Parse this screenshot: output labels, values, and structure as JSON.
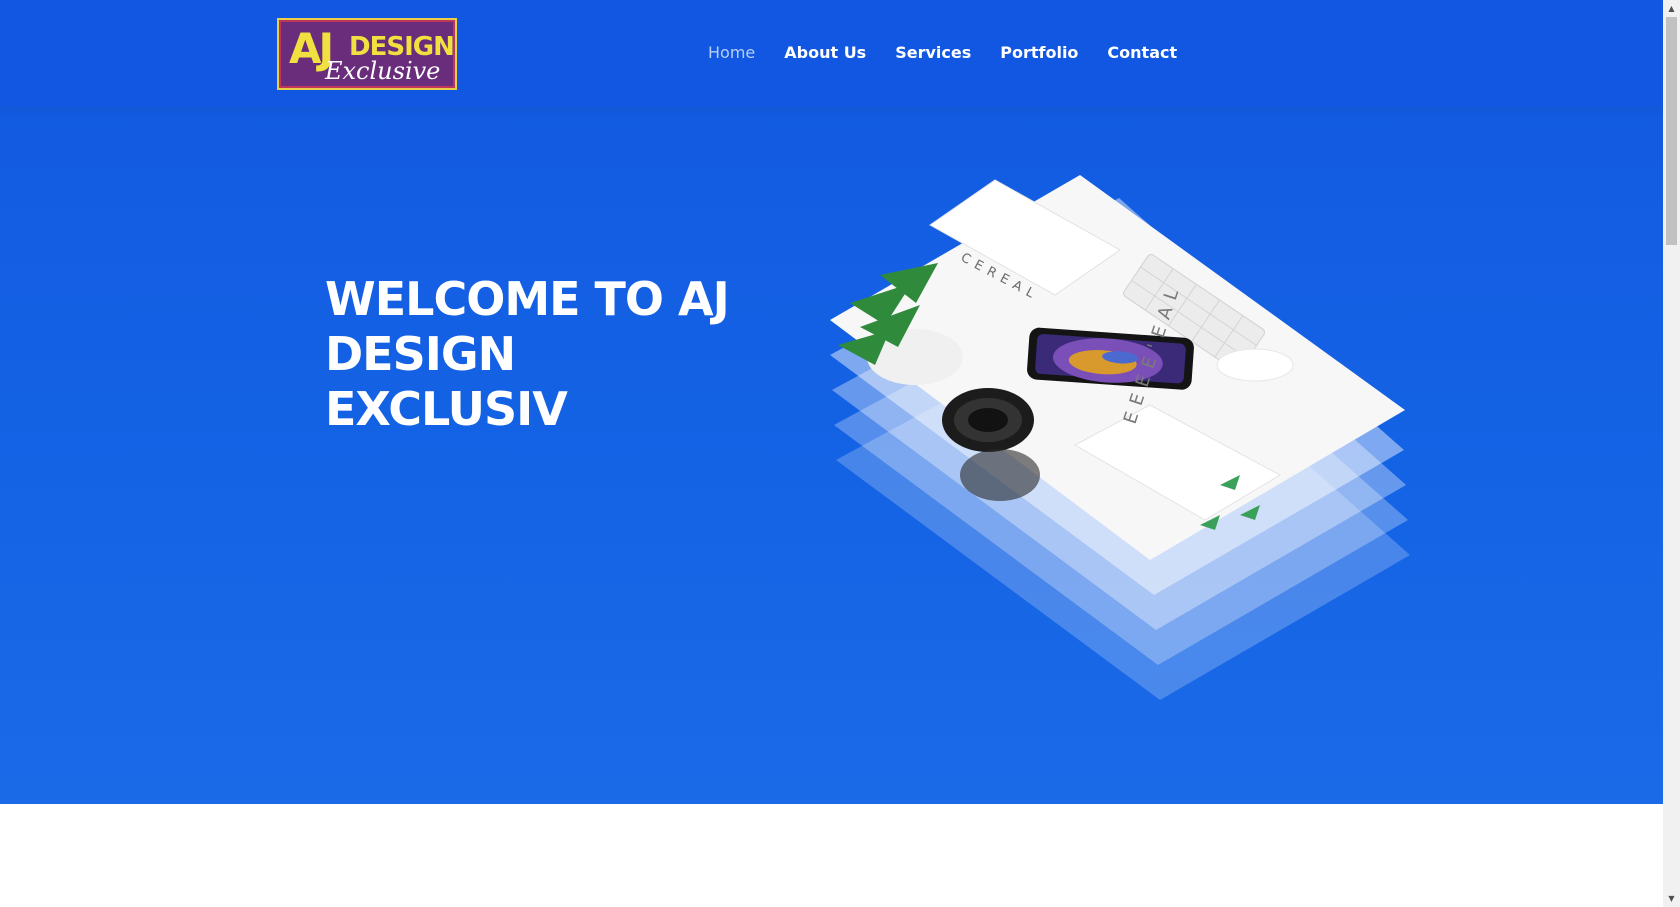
{
  "logo": {
    "aj": "AJ",
    "design": "DESIGN",
    "exclusive": "Exclusive"
  },
  "nav": {
    "items": [
      {
        "label": "Home",
        "active": true
      },
      {
        "label": "About Us",
        "active": false
      },
      {
        "label": "Services",
        "active": false
      },
      {
        "label": "Portfolio",
        "active": false
      },
      {
        "label": "Contact",
        "active": false
      }
    ]
  },
  "hero": {
    "title_lines": [
      "WELCOME TO AJ",
      "DESIGN",
      "EXCLUSIV"
    ],
    "image_texts": {
      "cereal": "CEREAL",
      "ideal": "EEEE'EAL"
    }
  },
  "colors": {
    "hero_bg": "#1565e6",
    "header_bg": "#1157e2",
    "logo_bg": "#6a2d7c",
    "logo_text": "#f0e040",
    "nav_active": "#b6d0f5"
  }
}
